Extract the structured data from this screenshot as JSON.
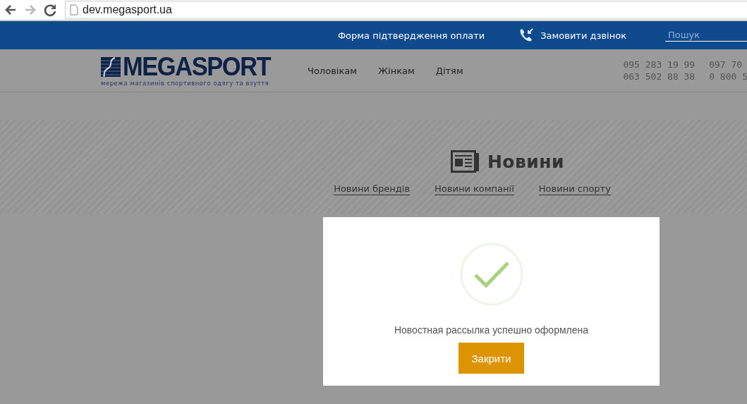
{
  "browser": {
    "url": "dev.megasport.ua"
  },
  "top_bar": {
    "payment_link": "Форма підтвердження оплати",
    "callback_link": "Замовити дзвінок",
    "search": {
      "placeholder": "Пошук"
    }
  },
  "header": {
    "logo": {
      "name": "MEGASPORT",
      "tagline": "мережа магазинів спортивного одягу та взуття"
    },
    "nav": [
      "Чоловікам",
      "Жінкам",
      "Дітям"
    ],
    "phones": [
      "095 283 19 99",
      "097 70",
      "063 502 88 38",
      "0 800 5"
    ]
  },
  "news": {
    "title": "Новини",
    "links": [
      "Новини брендів",
      "Новини компанії",
      "Новини спорту"
    ]
  },
  "modal": {
    "message": "Новостная рассылка успешно оформлена",
    "button": "Закрити"
  }
}
